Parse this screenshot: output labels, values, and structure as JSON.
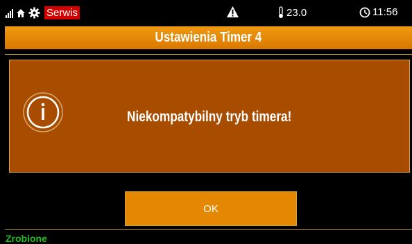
{
  "status_bar": {
    "service_label": "Serwis",
    "temperature": "23.0",
    "time": "11:56"
  },
  "title": "Ustawienia Timer 4",
  "dialog": {
    "message": "Niekompatybilny tryb timera!",
    "icon": "info-icon"
  },
  "ok_button_label": "OK",
  "footer_status": "Zrobione",
  "colors": {
    "accent_orange": "#e38800",
    "dialog_brown": "#a84c00",
    "service_red": "#d40000",
    "footer_green": "#1fbf1f"
  }
}
